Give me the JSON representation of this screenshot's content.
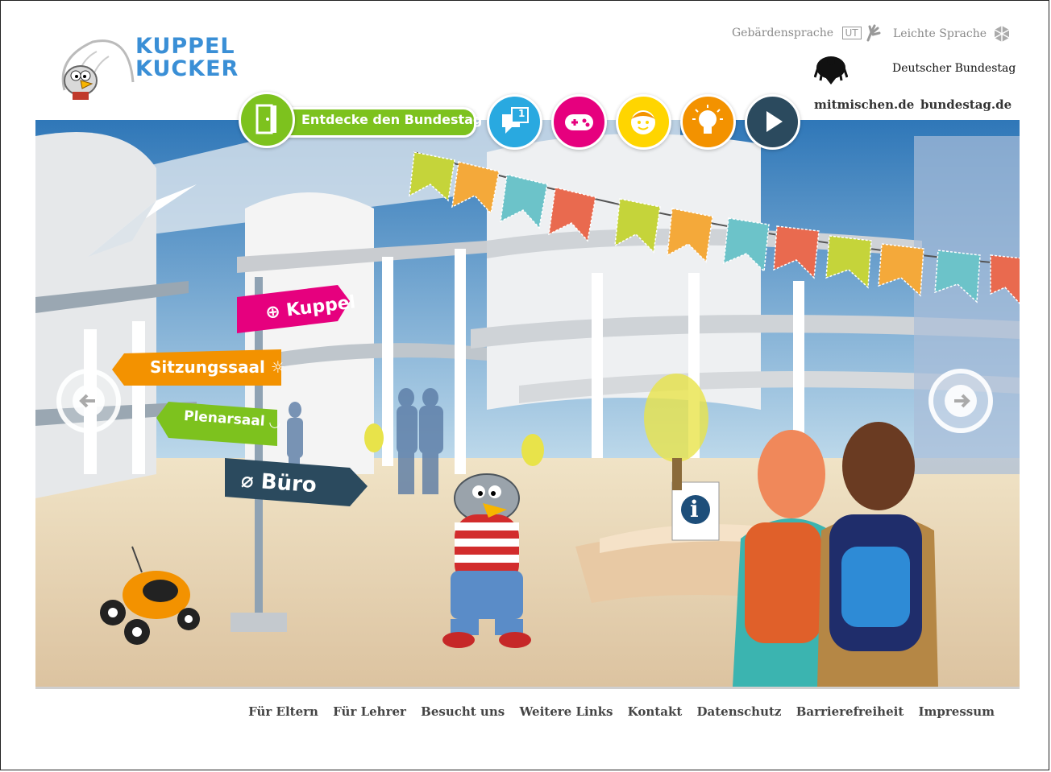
{
  "header": {
    "logo_line1": "KUPPEL",
    "logo_line2": "KUCKER",
    "sign_language_label": "Gebärdensprache",
    "sign_language_badge": "UT",
    "easy_language_label": "Leichte Sprache",
    "org_name": "Deutscher Bundestag",
    "links": [
      "mitmischen.de",
      "bundestag.de"
    ]
  },
  "nav": {
    "main_label": "Entdecke den Bundestag",
    "chat_count": "1",
    "buttons": [
      "door-icon",
      "chat-icon",
      "gamepad-icon",
      "face-icon",
      "lightbulb-icon",
      "play-icon"
    ]
  },
  "signpost": {
    "kuppel": "Kuppel",
    "sitzungssaal": "Sitzungssaal",
    "plenarsaal": "Plenarsaal",
    "buero": "Büro"
  },
  "info_sign": "i",
  "footer": {
    "links": [
      "Für Eltern",
      "Für Lehrer",
      "Besucht uns",
      "Weitere Links",
      "Kontakt",
      "Datenschutz",
      "Barrierefreiheit",
      "Impressum"
    ]
  },
  "colors": {
    "green": "#7dc21e",
    "blue": "#29a9e0",
    "magenta": "#e6007e",
    "yellow": "#ffd500",
    "orange": "#f39200",
    "dark": "#2b4a5e"
  }
}
